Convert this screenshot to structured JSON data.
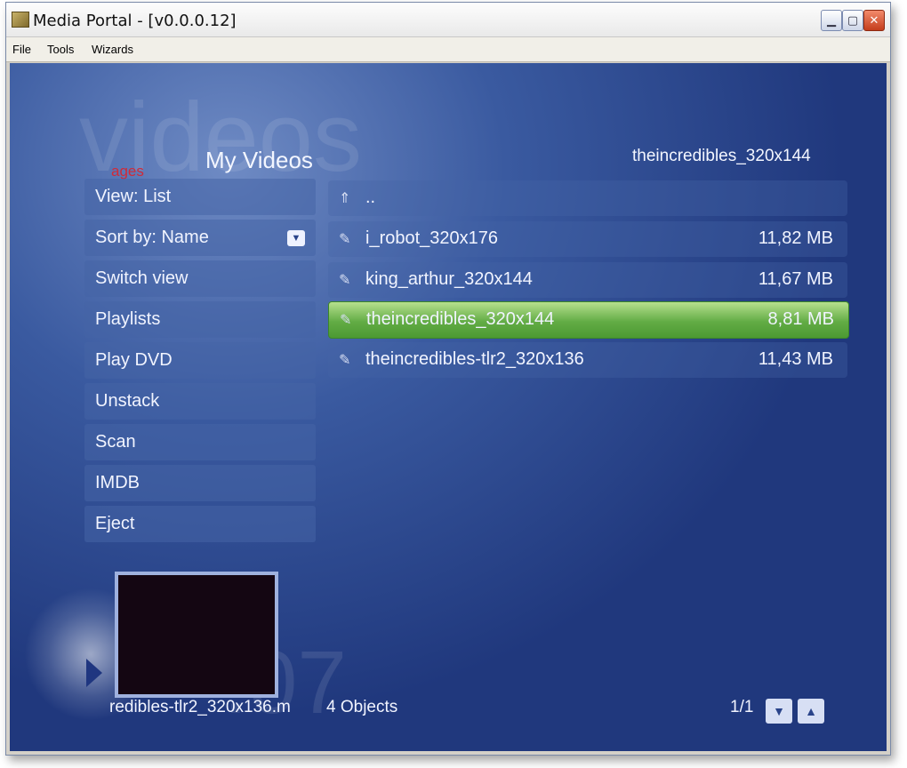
{
  "window": {
    "title": "Media Portal - [v0.0.0.12]"
  },
  "menubar": {
    "items": [
      "File",
      "Tools",
      "Wizards"
    ]
  },
  "page": {
    "background_title": "videos",
    "title": "My Videos",
    "ages_mark": "ages",
    "selected_item_title": "theincredibles_320x144"
  },
  "sidebar": {
    "items": [
      {
        "label": "View: List"
      },
      {
        "label": "Sort by: Name"
      },
      {
        "label": "Switch view"
      },
      {
        "label": "Playlists"
      },
      {
        "label": "Play DVD"
      },
      {
        "label": "Unstack"
      },
      {
        "label": "Scan"
      },
      {
        "label": "IMDB"
      },
      {
        "label": "Eject"
      }
    ]
  },
  "list": {
    "up_item": "..",
    "files": [
      {
        "name": "i_robot_320x176",
        "size": "11,82 MB"
      },
      {
        "name": "king_arthur_320x144",
        "size": "11,67 MB"
      },
      {
        "name": "theincredibles_320x144",
        "size": "8,81 MB",
        "selected": true
      },
      {
        "name": "theincredibles-tlr2_320x136",
        "size": "11,43 MB"
      }
    ]
  },
  "footer": {
    "now_playing": "redibles-tlr2_320x136.m",
    "background_time": ":07",
    "object_count": "4 Objects",
    "page_indicator": "1/1"
  },
  "colors": {
    "background": "#2b4a92",
    "selected_row": "#62ac45",
    "text": "#f1f4ff"
  }
}
